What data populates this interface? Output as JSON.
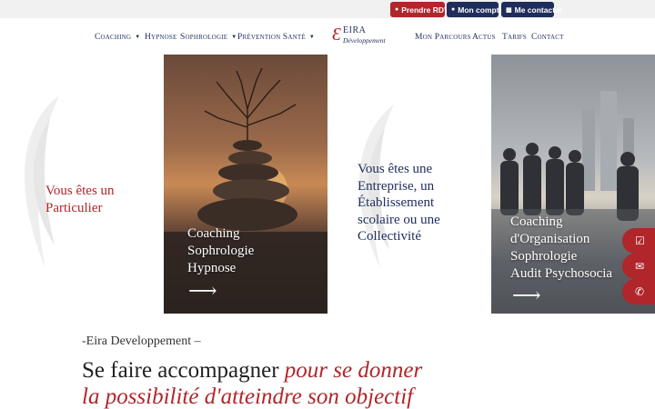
{
  "topbar": {
    "rdv_label": "Prendre RDV",
    "account_label": "Mon compte",
    "contact_label": "Me contacter",
    "rdv_icon": "user-icon",
    "account_icon": "user-icon",
    "contact_icon": "contact-card-icon"
  },
  "nav": {
    "left": [
      {
        "label": "Coaching",
        "dropdown": true
      },
      {
        "label": "Hypnose",
        "dropdown": false
      },
      {
        "label": "Sophrologie",
        "dropdown": true
      },
      {
        "label": "Prévention Santé",
        "dropdown": true
      }
    ],
    "right": [
      {
        "label": "Mon Parcours"
      },
      {
        "label": "Actus"
      },
      {
        "label": "Tarifs"
      },
      {
        "label": "Contact"
      }
    ],
    "logo": {
      "name": "EIRA",
      "sub": "Développement"
    }
  },
  "hero": {
    "p1": {
      "lines": [
        "Vous êtes un",
        "Particulier"
      ]
    },
    "p2": {
      "lines": [
        "Coaching",
        "Sophrologie",
        "Hypnose"
      ]
    },
    "p3": {
      "lines": [
        "Vous êtes une",
        "Entreprise, un",
        "Établissement",
        "scolaire ou une",
        "Collectivité"
      ]
    },
    "p4": {
      "lines": [
        "Coaching",
        "d'Organisation",
        "Sophrologie",
        "Audit Psychosocia"
      ]
    },
    "arrow": "⟶"
  },
  "fabs": [
    {
      "icon": "calendar-check-icon",
      "glyph": "☑"
    },
    {
      "icon": "envelope-icon",
      "glyph": "✉"
    },
    {
      "icon": "phone-icon",
      "glyph": "✆"
    }
  ],
  "section": {
    "eyebrow": "-Eira Developpement –",
    "headline_plain": "Se faire accompagner ",
    "headline_em1": "pour se donner",
    "headline_em2": "la possibilité d'atteindre son objectif"
  },
  "colors": {
    "accent": "#b0262a",
    "navy": "#1f2d5c"
  }
}
